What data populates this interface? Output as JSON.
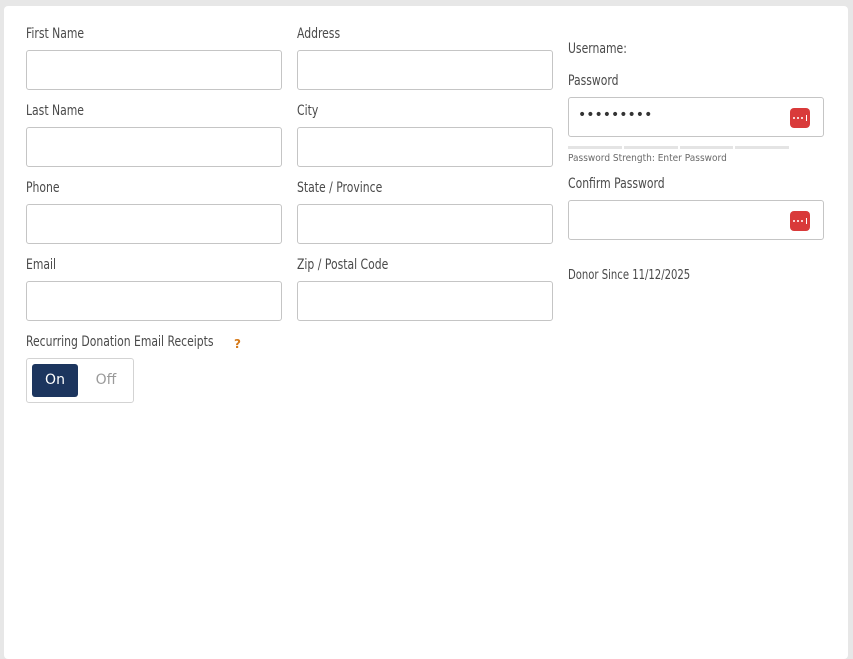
{
  "form": {
    "first_name": {
      "label": "First Name",
      "value": ""
    },
    "last_name": {
      "label": "Last Name",
      "value": ""
    },
    "phone": {
      "label": "Phone",
      "value": ""
    },
    "email": {
      "label": "Email",
      "value": ""
    },
    "address": {
      "label": "Address",
      "value": ""
    },
    "city": {
      "label": "City",
      "value": ""
    },
    "state": {
      "label": "State / Province",
      "value": ""
    },
    "zip": {
      "label": "Zip / Postal Code",
      "value": ""
    }
  },
  "account": {
    "username_label": "Username:",
    "password_label": "Password",
    "password_mask": "•••••••••",
    "strength_text": "Password Strength: Enter Password",
    "confirm_label": "Confirm Password",
    "confirm_mask": "",
    "donor_since": "Donor Since 11/12/2025",
    "key_icon": "password-manager-icon",
    "key_icon_color": "#d93a3a"
  },
  "receipts": {
    "label": "Recurring Donation Email Receipts",
    "help_glyph": "?",
    "on_label": "On",
    "off_label": "Off",
    "selected": "On",
    "on_color": "#1c355e",
    "help_color": "#d67a1a"
  }
}
